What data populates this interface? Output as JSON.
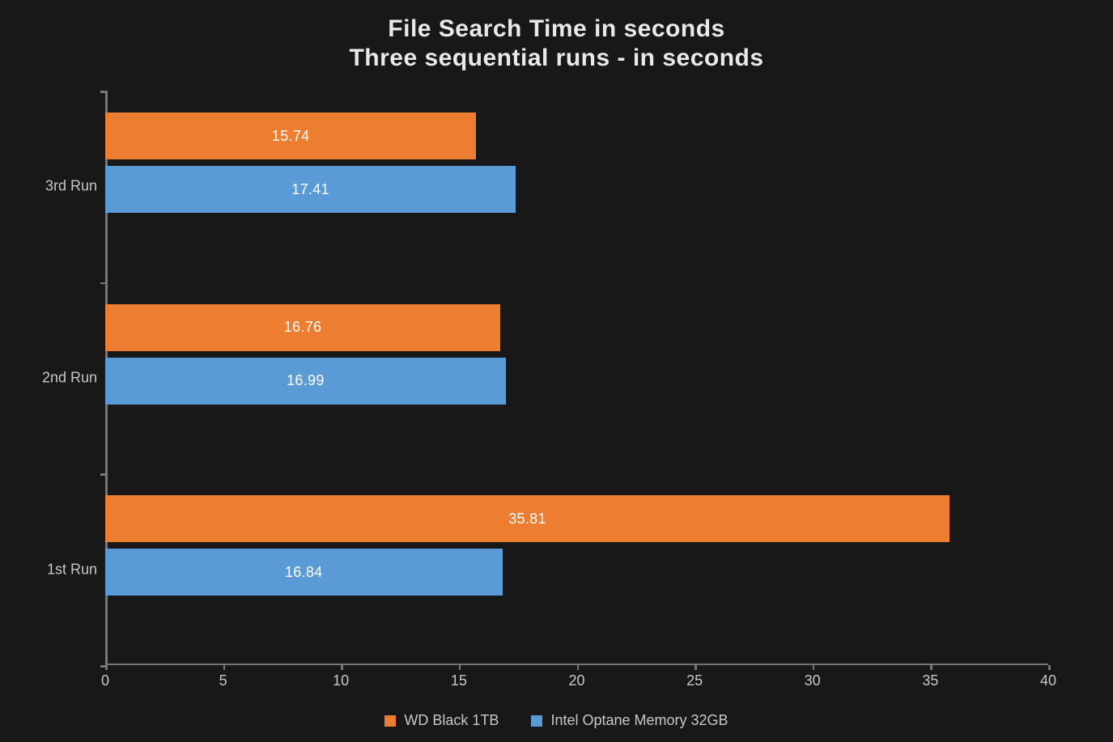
{
  "title_line1": "File Search Time in seconds",
  "title_line2": "Three sequential runs - in seconds",
  "legend": {
    "wd": "WD Black 1TB",
    "intel": "Intel Optane Memory 32GB"
  },
  "x_ticks": [
    "0",
    "5",
    "10",
    "15",
    "20",
    "25",
    "30",
    "35",
    "40"
  ],
  "categories": {
    "run3": "3rd Run",
    "run2": "2nd Run",
    "run1": "1st Run"
  },
  "values": {
    "run3": {
      "wd": "15.74",
      "intel": "17.41"
    },
    "run2": {
      "wd": "16.76",
      "intel": "16.99"
    },
    "run1": {
      "wd": "35.81",
      "intel": "16.84"
    }
  },
  "chart_data": {
    "type": "bar",
    "orientation": "horizontal",
    "title": "File Search Time in seconds",
    "subtitle": "Three sequential runs - in seconds",
    "xlabel": "",
    "ylabel": "",
    "xlim": [
      0,
      40
    ],
    "x_ticks": [
      0,
      5,
      10,
      15,
      20,
      25,
      30,
      35,
      40
    ],
    "categories": [
      "1st Run",
      "2nd Run",
      "3rd Run"
    ],
    "series": [
      {
        "name": "WD Black 1TB",
        "color": "#ed7d31",
        "values": [
          35.81,
          16.76,
          15.74
        ]
      },
      {
        "name": "Intel Optane Memory 32GB",
        "color": "#5b9bd5",
        "values": [
          16.84,
          16.99,
          17.41
        ]
      }
    ],
    "legend_position": "bottom",
    "grid": false
  }
}
